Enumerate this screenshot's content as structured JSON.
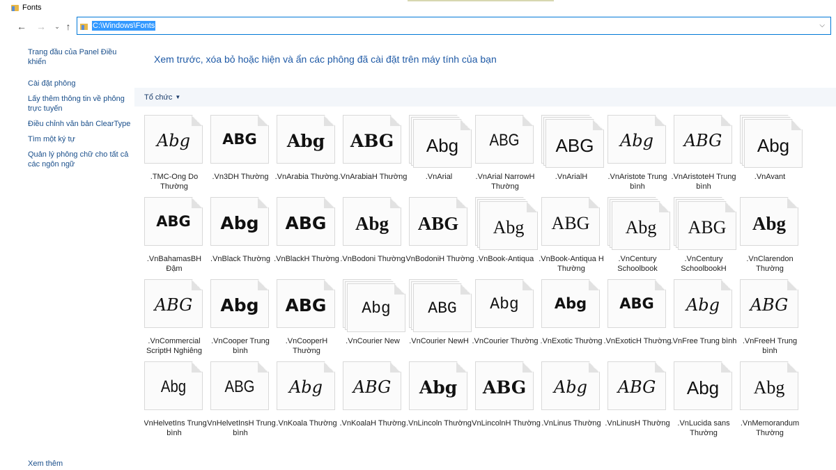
{
  "window": {
    "title": "Fonts"
  },
  "address": {
    "path": "C:\\Windows\\Fonts"
  },
  "sidebar": {
    "items": [
      {
        "label": "Trang đầu của Panel Điều khiển"
      },
      {
        "label": "Cài đặt phông"
      },
      {
        "label": "Lấy thêm thông tin về phông trực tuyến"
      },
      {
        "label": "Điều chỉnh văn bản ClearType"
      },
      {
        "label": "Tìm một ký tự"
      },
      {
        "label": "Quản lý phông chữ cho tất cả các ngôn ngữ"
      }
    ],
    "footer": "Xem thêm"
  },
  "main": {
    "heading": "Xem trước, xóa bỏ hoặc hiện và ẩn các phông đã cài đặt trên máy tính của bạn",
    "organize_label": "Tổ chức"
  },
  "fonts": [
    {
      "name": ".TMC-Ong Do Thường",
      "sample": "Abg",
      "style": "script",
      "stack": false
    },
    {
      "name": ".Vn3DH Thường",
      "sample": "ABG",
      "style": "bold",
      "stack": false
    },
    {
      "name": ".VnArabia Thường",
      "sample": "Abg",
      "style": "blackletter",
      "stack": false
    },
    {
      "name": ".VnArabiaH Thường",
      "sample": "ABG",
      "style": "blackletter",
      "stack": false
    },
    {
      "name": ".VnArial",
      "sample": "Abg",
      "style": "sans",
      "stack": true
    },
    {
      "name": ".VnArial NarrowH Thường",
      "sample": "ABG",
      "style": "narrow",
      "stack": false
    },
    {
      "name": ".VnArialH",
      "sample": "ABG",
      "style": "sans",
      "stack": true
    },
    {
      "name": ".VnAristote Trung bình",
      "sample": "Abg",
      "style": "script",
      "stack": false
    },
    {
      "name": ".VnAristoteH Trung bình",
      "sample": "ABG",
      "style": "script",
      "stack": false
    },
    {
      "name": ".VnAvant",
      "sample": "Abg",
      "style": "sans",
      "stack": true
    },
    {
      "name": ".VnBahamasBH Đậm",
      "sample": "ABG",
      "style": "bold",
      "stack": false
    },
    {
      "name": ".VnBlack Thường",
      "sample": "Abg",
      "style": "heavy",
      "stack": false
    },
    {
      "name": ".VnBlackH Thường",
      "sample": "ABG",
      "style": "heavy",
      "stack": false
    },
    {
      "name": ".VnBodoni Thường",
      "sample": "Abg",
      "style": "serifbold",
      "stack": false
    },
    {
      "name": ".VnBodoniH Thường",
      "sample": "ABG",
      "style": "serifbold",
      "stack": false
    },
    {
      "name": ".VnBook-Antiqua",
      "sample": "Abg",
      "style": "serif",
      "stack": true
    },
    {
      "name": ".VnBook-Antiqua H Thường",
      "sample": "ABG",
      "style": "serif",
      "stack": false
    },
    {
      "name": ".VnCentury Schoolbook",
      "sample": "Abg",
      "style": "serif",
      "stack": true
    },
    {
      "name": ".VnCentury SchoolbookH",
      "sample": "ABG",
      "style": "serif",
      "stack": true
    },
    {
      "name": ".VnClarendon Thường",
      "sample": "Abg",
      "style": "serifbold",
      "stack": false
    },
    {
      "name": ".VnCommercial ScriptH Nghiêng",
      "sample": "ABG",
      "style": "script",
      "stack": false
    },
    {
      "name": ".VnCooper Trung bình",
      "sample": "Abg",
      "style": "heavy",
      "stack": false
    },
    {
      "name": ".VnCooperH Thường",
      "sample": "ABG",
      "style": "heavy",
      "stack": false
    },
    {
      "name": ".VnCourier New",
      "sample": "Abg",
      "style": "mono",
      "stack": true
    },
    {
      "name": ".VnCourier NewH",
      "sample": "ABG",
      "style": "mono",
      "stack": true
    },
    {
      "name": ".VnCourier Thường",
      "sample": "Abg",
      "style": "mono",
      "stack": false
    },
    {
      "name": ".VnExotic Thường",
      "sample": "Abg",
      "style": "bold",
      "stack": false
    },
    {
      "name": ".VnExoticH Thường",
      "sample": "ABG",
      "style": "bold",
      "stack": false
    },
    {
      "name": ".VnFree Trung bình",
      "sample": "Abg",
      "style": "script",
      "stack": false
    },
    {
      "name": ".VnFreeH Trung bình",
      "sample": "ABG",
      "style": "script",
      "stack": false
    },
    {
      "name": ".VnHelvetIns Trung bình",
      "sample": "Abg",
      "style": "narrow",
      "stack": false
    },
    {
      "name": ".VnHelvetInsH Trung bình",
      "sample": "ABG",
      "style": "narrow",
      "stack": false
    },
    {
      "name": ".VnKoala Thường",
      "sample": "Abg",
      "style": "script",
      "stack": false
    },
    {
      "name": ".VnKoalaH Thường",
      "sample": "ABG",
      "style": "script",
      "stack": false
    },
    {
      "name": ".VnLincoln Thường",
      "sample": "Abg",
      "style": "blackletter",
      "stack": false
    },
    {
      "name": ".VnLincolnH Thường",
      "sample": "ABG",
      "style": "blackletter",
      "stack": false
    },
    {
      "name": ".VnLinus Thường",
      "sample": "Abg",
      "style": "script",
      "stack": false
    },
    {
      "name": ".VnLinusH Thường",
      "sample": "ABG",
      "style": "script",
      "stack": false
    },
    {
      "name": ".VnLucida sans Thường",
      "sample": "Abg",
      "style": "sans",
      "stack": false
    },
    {
      "name": ".VnMemorandum Thường",
      "sample": "Abg",
      "style": "serif",
      "stack": false
    }
  ]
}
